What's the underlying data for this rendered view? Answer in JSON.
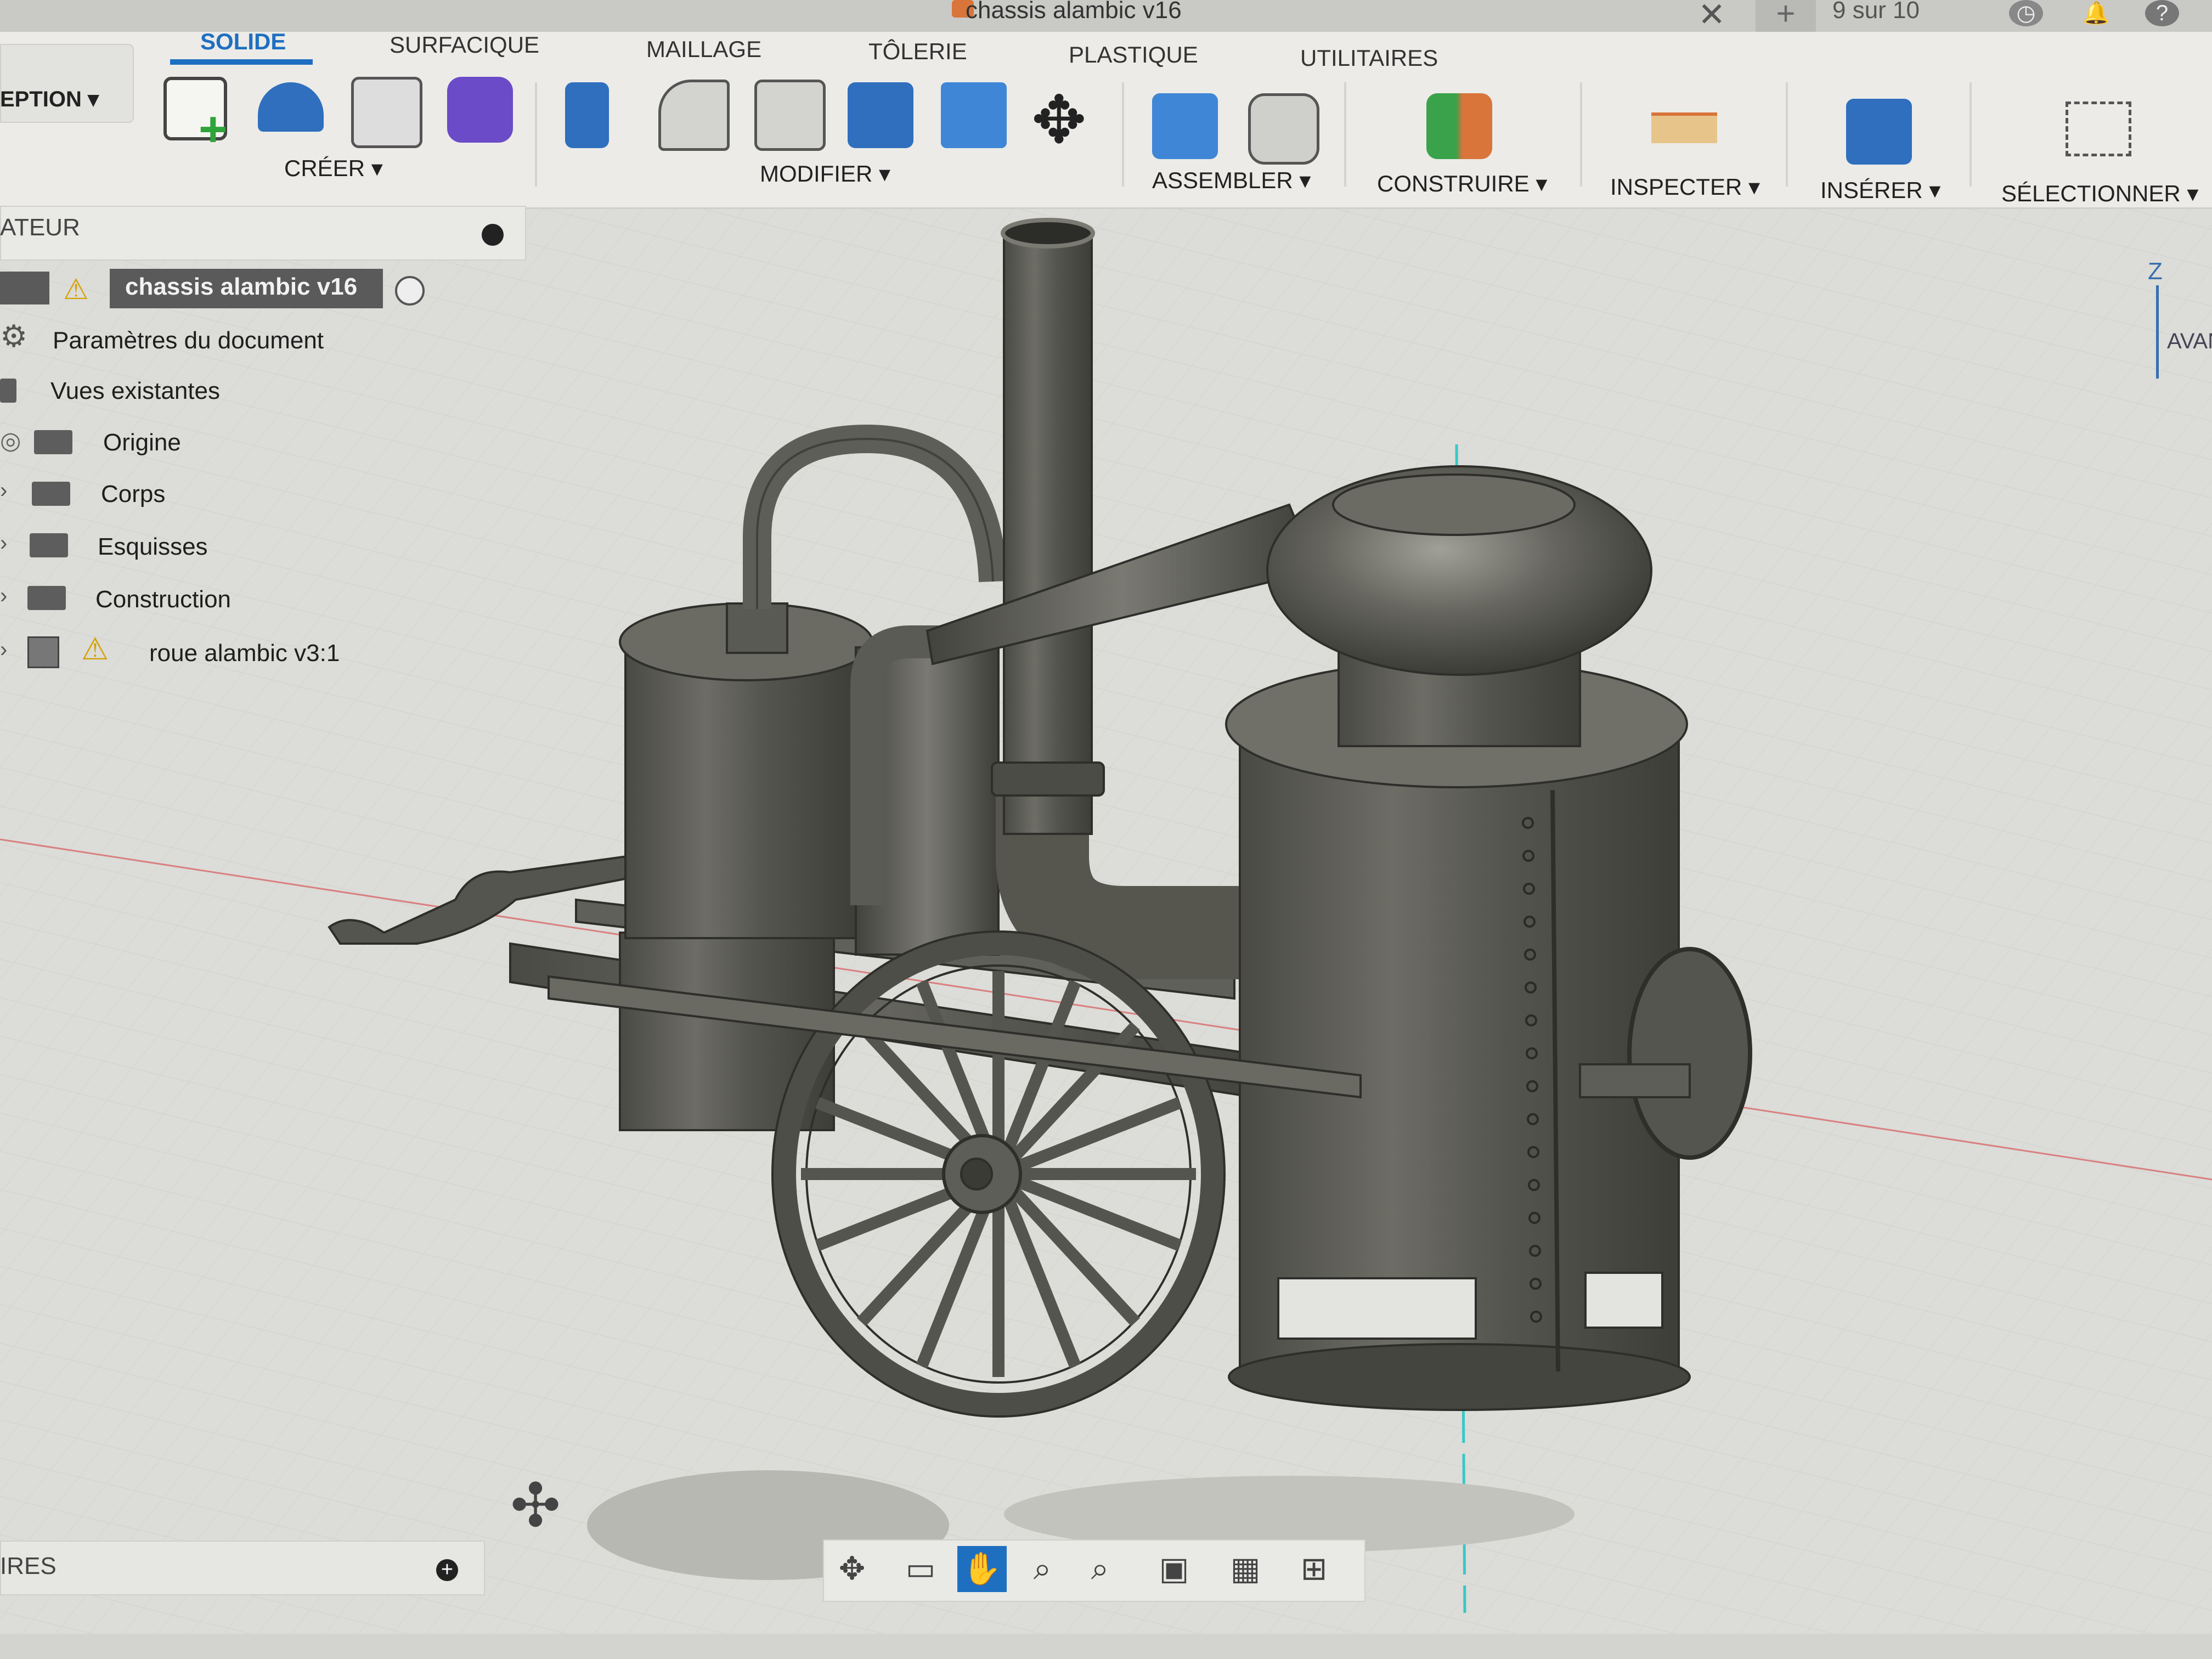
{
  "window": {
    "title": "chassis alambic v16",
    "pager": "9 sur 10",
    "close_glyph": "✕",
    "new_tab_glyph": "+"
  },
  "toolbar": {
    "workspace": "EPTION ▾",
    "tabs": [
      "SOLIDE",
      "SURFACIQUE",
      "MAILLAGE",
      "TÔLERIE",
      "PLASTIQUE",
      "UTILITAIRES"
    ],
    "active_tab": "SOLIDE",
    "groups": {
      "create": "CRÉER ▾",
      "modify": "MODIFIER ▾",
      "assemble": "ASSEMBLER ▾",
      "construct": "CONSTRUIRE ▾",
      "inspect": "INSPECTER ▾",
      "insert": "INSÉRER ▾",
      "select": "SÉLECTIONNER ▾"
    }
  },
  "browser": {
    "header": "ATEUR",
    "root": "chassis alambic v16",
    "items": [
      {
        "label": "Paramètres du document",
        "icon": "gear-icon"
      },
      {
        "label": "Vues existantes",
        "icon": "folder-icon"
      },
      {
        "label": "Origine",
        "icon": "folder-icon"
      },
      {
        "label": "Corps",
        "icon": "folder-icon"
      },
      {
        "label": "Esquisses",
        "icon": "folder-icon"
      },
      {
        "label": "Construction",
        "icon": "folder-icon"
      },
      {
        "label": "roue alambic v3:1",
        "icon": "component-icon"
      }
    ]
  },
  "bottom_panel": {
    "label": "IRES",
    "add_glyph": "+"
  },
  "viewcube": {
    "axis": "Z",
    "face": "AVAN"
  },
  "nav_tools": [
    "orbit-icon",
    "look-at-icon",
    "pan-icon",
    "zoom-icon",
    "zoom-window-icon",
    "display-icon",
    "grid-icon",
    "viewports-icon"
  ],
  "colors": {
    "accent": "#1f6fc1",
    "model": "#5b5b55",
    "axis_cyan": "#37c8c8",
    "axis_red": "#d98080",
    "canvas": "#dcdcd8"
  }
}
